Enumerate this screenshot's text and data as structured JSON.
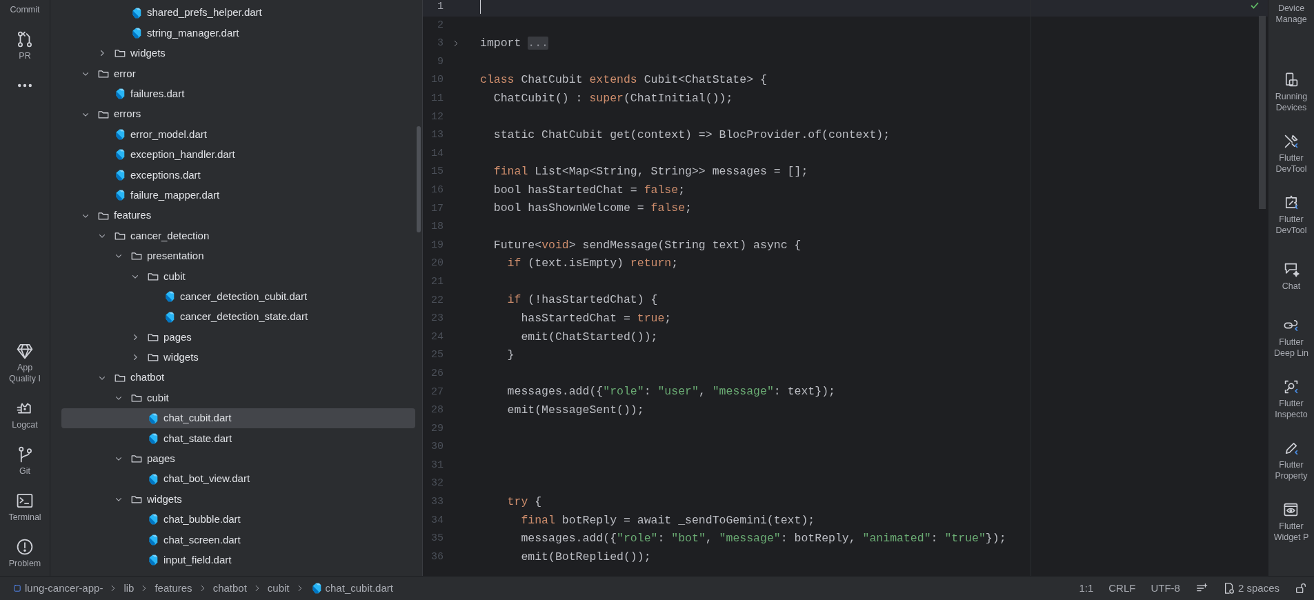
{
  "left_toolbar": {
    "top": [
      {
        "label": "Commit"
      },
      {
        "kind": "pr",
        "label": "PR"
      },
      {
        "kind": "more"
      }
    ],
    "bottom": [
      {
        "kind": "quality",
        "label": "App Quality I"
      },
      {
        "kind": "logcat",
        "label": "Logcat"
      },
      {
        "kind": "git",
        "label": "Git"
      },
      {
        "kind": "terminal",
        "label": "Terminal"
      },
      {
        "kind": "problems",
        "label": "Problem"
      }
    ]
  },
  "project_tree": {
    "items": [
      {
        "kind": "group",
        "children": [
          {
            "kind": "group",
            "children": [
              {
                "kind": "file",
                "name": "shared_prefs_helper.dart",
                "selected": false
              },
              {
                "kind": "file",
                "name": "string_manager.dart",
                "selected": false
              }
            ]
          },
          {
            "kind": "folder",
            "name": "widgets",
            "expanded": false
          }
        ]
      },
      {
        "kind": "folder",
        "name": "error",
        "expanded": true,
        "children": [
          {
            "kind": "file",
            "name": "failures.dart",
            "selected": false
          }
        ]
      },
      {
        "kind": "folder",
        "name": "errors",
        "expanded": true,
        "children": [
          {
            "kind": "file",
            "name": "error_model.dart",
            "selected": false
          },
          {
            "kind": "file",
            "name": "exception_handler.dart",
            "selected": false
          },
          {
            "kind": "file",
            "name": "exceptions.dart",
            "selected": false
          },
          {
            "kind": "file",
            "name": "failure_mapper.dart",
            "selected": false
          }
        ]
      },
      {
        "kind": "folder",
        "name": "features",
        "expanded": true,
        "children": [
          {
            "kind": "folder",
            "name": "cancer_detection",
            "expanded": true,
            "children": [
              {
                "kind": "folder",
                "name": "presentation",
                "expanded": true,
                "children": [
                  {
                    "kind": "folder",
                    "name": "cubit",
                    "expanded": true,
                    "children": [
                      {
                        "kind": "file",
                        "name": "cancer_detection_cubit.dart",
                        "selected": false
                      },
                      {
                        "kind": "file",
                        "name": "cancer_detection_state.dart",
                        "selected": false
                      }
                    ]
                  },
                  {
                    "kind": "folder",
                    "name": "pages",
                    "expanded": false
                  },
                  {
                    "kind": "folder",
                    "name": "widgets",
                    "expanded": false
                  }
                ]
              }
            ]
          },
          {
            "kind": "folder",
            "name": "chatbot",
            "expanded": true,
            "children": [
              {
                "kind": "folder",
                "name": "cubit",
                "expanded": true,
                "children": [
                  {
                    "kind": "file",
                    "name": "chat_cubit.dart",
                    "selected": true
                  },
                  {
                    "kind": "file",
                    "name": "chat_state.dart",
                    "selected": false
                  }
                ]
              },
              {
                "kind": "folder",
                "name": "pages",
                "expanded": true,
                "children": [
                  {
                    "kind": "file",
                    "name": "chat_bot_view.dart",
                    "selected": false
                  }
                ]
              },
              {
                "kind": "folder",
                "name": "widgets",
                "expanded": true,
                "children": [
                  {
                    "kind": "file",
                    "name": "chat_bubble.dart",
                    "selected": false
                  },
                  {
                    "kind": "file",
                    "name": "chat_screen.dart",
                    "selected": false
                  },
                  {
                    "kind": "file",
                    "name": "input_field.dart",
                    "selected": false
                  }
                ]
              }
            ]
          }
        ]
      }
    ]
  },
  "editor": {
    "lines": [
      {
        "number": "1",
        "current": true,
        "folded": false
      },
      {
        "number": "2",
        "current": false,
        "folded": false
      },
      {
        "number": "3",
        "current": false,
        "folded": true,
        "tokens": [
          {
            "kind": "plain",
            "text": "import "
          },
          {
            "kind": "fold",
            "text": "..."
          }
        ]
      },
      {
        "number": "9",
        "current": false,
        "folded": false
      },
      {
        "number": "10",
        "current": false,
        "folded": false,
        "tokens": [
          {
            "kind": "kw",
            "text": "class"
          },
          {
            "kind": "plain",
            "text": " ChatCubit "
          },
          {
            "kind": "kw",
            "text": "extends"
          },
          {
            "kind": "plain",
            "text": " Cubit<ChatState> {"
          }
        ]
      },
      {
        "number": "11",
        "current": false,
        "folded": false,
        "tokens": [
          {
            "kind": "plain",
            "text": "  ChatCubit() : "
          },
          {
            "kind": "kw",
            "text": "super"
          },
          {
            "kind": "plain",
            "text": "(ChatInitial());"
          }
        ]
      },
      {
        "number": "12",
        "current": false,
        "folded": false
      },
      {
        "number": "13",
        "current": false,
        "folded": false,
        "tokens": [
          {
            "kind": "plain",
            "text": "  static ChatCubit get(context) => BlocProvider.of(context);"
          }
        ]
      },
      {
        "number": "14",
        "current": false,
        "folded": false
      },
      {
        "number": "15",
        "current": false,
        "folded": false,
        "tokens": [
          {
            "kind": "kw",
            "text": "  final"
          },
          {
            "kind": "plain",
            "text": " List<Map<String, String>> messages = [];"
          }
        ]
      },
      {
        "number": "16",
        "current": false,
        "folded": false,
        "tokens": [
          {
            "kind": "plain",
            "text": "  bool hasStartedChat = "
          },
          {
            "kind": "kw",
            "text": "false"
          },
          {
            "kind": "plain",
            "text": ";"
          }
        ]
      },
      {
        "number": "17",
        "current": false,
        "folded": false,
        "tokens": [
          {
            "kind": "plain",
            "text": "  bool hasShownWelcome = "
          },
          {
            "kind": "kw",
            "text": "false"
          },
          {
            "kind": "plain",
            "text": ";"
          }
        ]
      },
      {
        "number": "18",
        "current": false,
        "folded": false
      },
      {
        "number": "19",
        "current": false,
        "folded": false,
        "tokens": [
          {
            "kind": "plain",
            "text": "  Future<"
          },
          {
            "kind": "kw",
            "text": "void"
          },
          {
            "kind": "plain",
            "text": "> sendMessage(String text) async {"
          }
        ]
      },
      {
        "number": "20",
        "current": false,
        "folded": false,
        "tokens": [
          {
            "kind": "kw",
            "text": "    if"
          },
          {
            "kind": "plain",
            "text": " (text.isEmpty) "
          },
          {
            "kind": "kw",
            "text": "return"
          },
          {
            "kind": "plain",
            "text": ";"
          }
        ]
      },
      {
        "number": "21",
        "current": false,
        "folded": false
      },
      {
        "number": "22",
        "current": false,
        "folded": false,
        "tokens": [
          {
            "kind": "kw",
            "text": "    if"
          },
          {
            "kind": "plain",
            "text": " (!hasStartedChat) {"
          }
        ]
      },
      {
        "number": "23",
        "current": false,
        "folded": false,
        "tokens": [
          {
            "kind": "plain",
            "text": "      hasStartedChat = "
          },
          {
            "kind": "kw",
            "text": "true"
          },
          {
            "kind": "plain",
            "text": ";"
          }
        ]
      },
      {
        "number": "24",
        "current": false,
        "folded": false,
        "tokens": [
          {
            "kind": "plain",
            "text": "      emit(ChatStarted());"
          }
        ]
      },
      {
        "number": "25",
        "current": false,
        "folded": false,
        "tokens": [
          {
            "kind": "plain",
            "text": "    }"
          }
        ]
      },
      {
        "number": "26",
        "current": false,
        "folded": false
      },
      {
        "number": "27",
        "current": false,
        "folded": false,
        "tokens": [
          {
            "kind": "plain",
            "text": "    messages.add({"
          },
          {
            "kind": "str",
            "text": "\"role\""
          },
          {
            "kind": "plain",
            "text": ": "
          },
          {
            "kind": "str",
            "text": "\"user\""
          },
          {
            "kind": "plain",
            "text": ", "
          },
          {
            "kind": "str",
            "text": "\"message\""
          },
          {
            "kind": "plain",
            "text": ": text});"
          }
        ]
      },
      {
        "number": "28",
        "current": false,
        "folded": false,
        "tokens": [
          {
            "kind": "plain",
            "text": "    emit(MessageSent());"
          }
        ]
      },
      {
        "number": "29",
        "current": false,
        "folded": false
      },
      {
        "number": "30",
        "current": false,
        "folded": false
      },
      {
        "number": "31",
        "current": false,
        "folded": false
      },
      {
        "number": "32",
        "current": false,
        "folded": false
      },
      {
        "number": "33",
        "current": false,
        "folded": false,
        "tokens": [
          {
            "kind": "kw",
            "text": "    try"
          },
          {
            "kind": "plain",
            "text": " {"
          }
        ]
      },
      {
        "number": "34",
        "current": false,
        "folded": false,
        "tokens": [
          {
            "kind": "kw",
            "text": "      final"
          },
          {
            "kind": "plain",
            "text": " botReply = await _sendToGemini(text);"
          }
        ]
      },
      {
        "number": "35",
        "current": false,
        "folded": false,
        "tokens": [
          {
            "kind": "plain",
            "text": "      messages.add({"
          },
          {
            "kind": "str",
            "text": "\"role\""
          },
          {
            "kind": "plain",
            "text": ": "
          },
          {
            "kind": "str",
            "text": "\"bot\""
          },
          {
            "kind": "plain",
            "text": ", "
          },
          {
            "kind": "str",
            "text": "\"message\""
          },
          {
            "kind": "plain",
            "text": ": botReply, "
          },
          {
            "kind": "str",
            "text": "\"animated\""
          },
          {
            "kind": "plain",
            "text": ": "
          },
          {
            "kind": "str",
            "text": "\"true\""
          },
          {
            "kind": "plain",
            "text": "});"
          }
        ]
      },
      {
        "number": "36",
        "current": false,
        "folded": false,
        "tokens": [
          {
            "kind": "plain",
            "text": "      emit(BotReplied());"
          }
        ]
      }
    ]
  },
  "right_toolbar": [
    {
      "label": "Device Manage"
    },
    {
      "kind": "running",
      "label": "Running Devices"
    },
    {
      "kind": "devtools",
      "label": "Flutter DevTool"
    },
    {
      "kind": "devtools2",
      "label": "Flutter DevTool"
    },
    {
      "kind": "chat",
      "label": "Chat"
    },
    {
      "kind": "deeplink",
      "label": "Flutter Deep Lin"
    },
    {
      "kind": "inspector",
      "label": "Flutter Inspecto"
    },
    {
      "kind": "property",
      "label": "Flutter Property"
    },
    {
      "kind": "widget",
      "label": "Flutter Widget P"
    }
  ],
  "status_bar": {
    "breadcrumbs": [
      {
        "kind": "module",
        "text": "lung-cancer-app-"
      },
      {
        "kind": "folder",
        "text": "lib"
      },
      {
        "kind": "folder",
        "text": "features"
      },
      {
        "kind": "folder",
        "text": "chatbot"
      },
      {
        "kind": "folder",
        "text": "cubit"
      },
      {
        "kind": "file",
        "text": "chat_cubit.dart"
      }
    ],
    "right": [
      {
        "kind": "text",
        "text": "1:1"
      },
      {
        "kind": "text",
        "text": "CRLF"
      },
      {
        "kind": "text",
        "text": "UTF-8"
      },
      {
        "kind": "format"
      },
      {
        "kind": "indent",
        "text": "2 spaces"
      },
      {
        "kind": "lock"
      }
    ]
  }
}
